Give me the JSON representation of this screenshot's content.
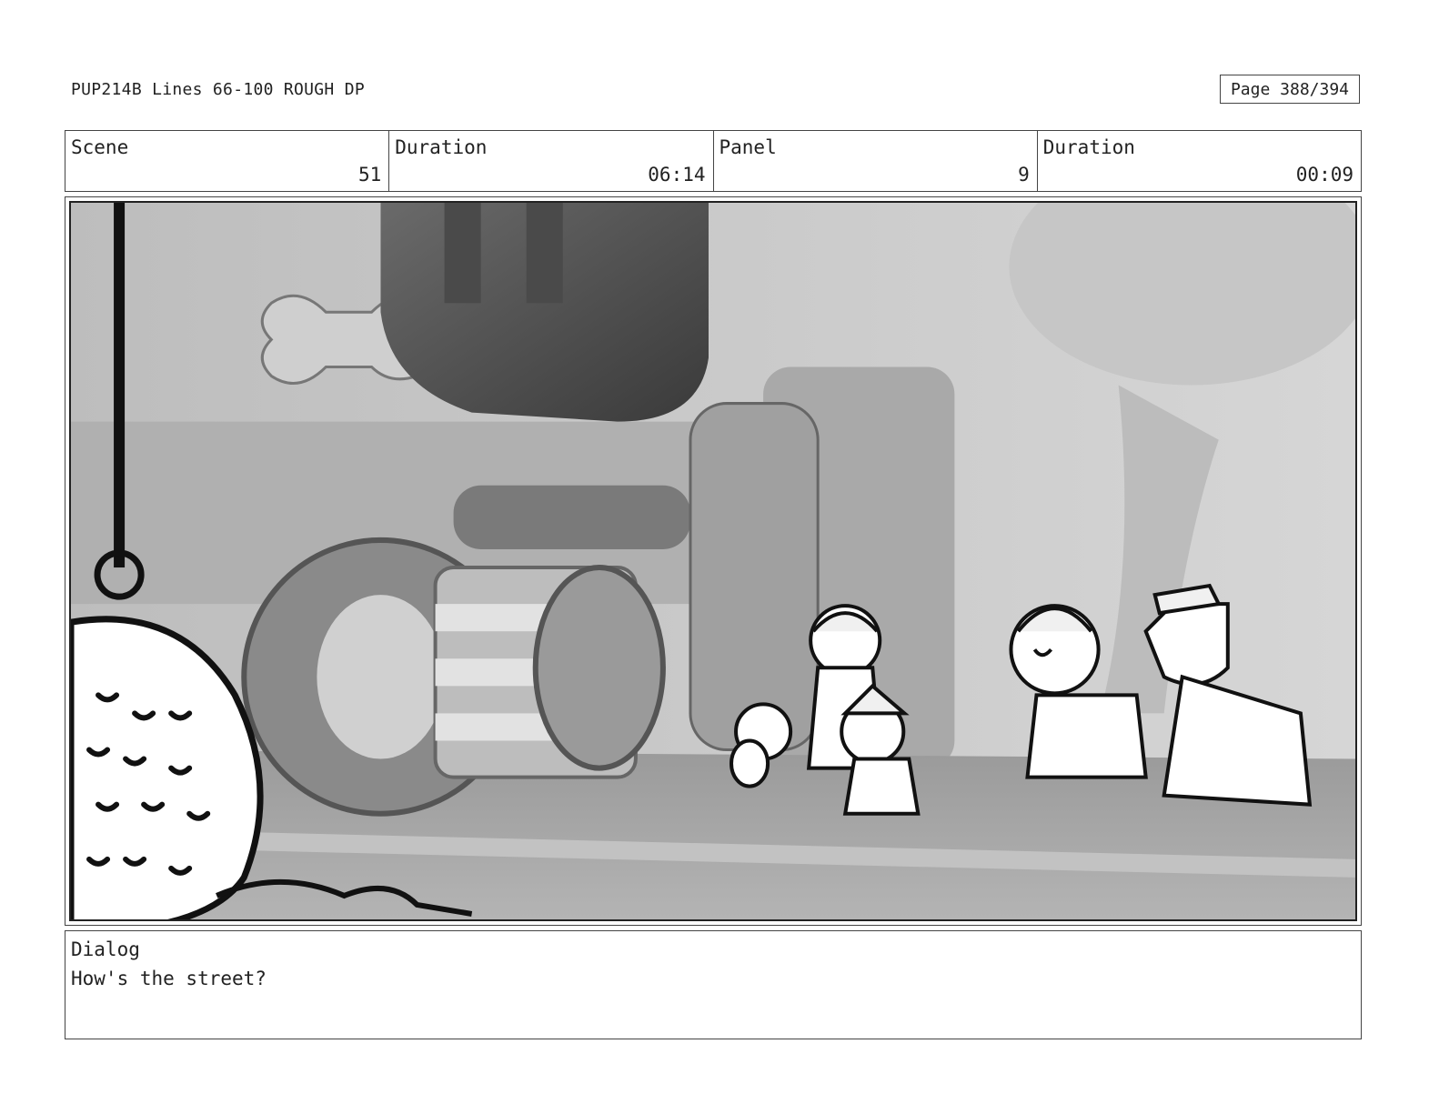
{
  "header": {
    "title": "PUP214B Lines 66-100 ROUGH DP",
    "page": "Page 388/394"
  },
  "info": {
    "scene_label": "Scene",
    "scene_value": "51",
    "scene_duration_label": "Duration",
    "scene_duration_value": "06:14",
    "panel_label": "Panel",
    "panel_value": "9",
    "panel_duration_label": "Duration",
    "panel_duration_value": "00:09"
  },
  "dialog": {
    "label": "Dialog",
    "text": "How's the street?"
  }
}
